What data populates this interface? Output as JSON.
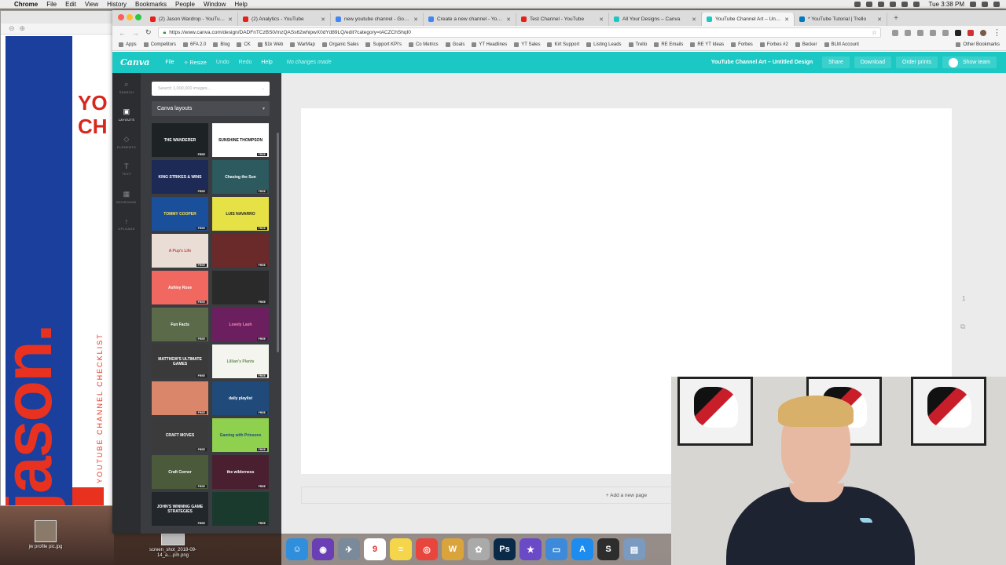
{
  "menubar": {
    "app": "Chrome",
    "items": [
      "File",
      "Edit",
      "View",
      "History",
      "Bookmarks",
      "People",
      "Window",
      "Help"
    ],
    "clock": "Tue 3:38 PM"
  },
  "background_window": {
    "poster_text_top": "YO",
    "poster_text_top2": "CH",
    "poster_brand": "jason.",
    "poster_vertical": "YOUTUBE CHANNEL CHECKLIST"
  },
  "desktop_icons": [
    {
      "label": "jw profile pic.jpg"
    },
    {
      "label": "screen_shot_2018-09-14_a....pm.png"
    }
  ],
  "tabs": [
    {
      "label": "(2) Jason Wardrop - YouTube",
      "color": "#e62117"
    },
    {
      "label": "(2) Analytics - YouTube",
      "color": "#e62117"
    },
    {
      "label": "new youtube channel - Google",
      "color": "#4285f4"
    },
    {
      "label": "Create a new channel - YouTu...",
      "color": "#4285f4"
    },
    {
      "label": "Test Channel - YouTube",
      "color": "#e62117"
    },
    {
      "label": "All Your Designs – Canva",
      "color": "#1bc8c3"
    },
    {
      "label": "YouTube Channel Art – Untitle...",
      "color": "#1bc8c3",
      "active": true
    },
    {
      "label": "* YouTube Tutorial | Trello",
      "color": "#0079bf"
    }
  ],
  "url": "https://www.canva.com/design/DADFnTCzBS0/mzQASs62whipwX0dYd89LQ/edit?category=tACZChShqI0",
  "bookmarks": [
    "Apps",
    "Competitors",
    "6FA 2.0",
    "Blog",
    "CK",
    "$1k Web",
    "WarMap",
    "Organic Sales",
    "Support KPI's",
    "Co Metrics",
    "Goals",
    "YT Headlines",
    "YT Sales",
    "Kirt Support",
    "Listing Leads",
    "Trello",
    "RE Emails",
    "RE YT Ideas",
    "Forbes",
    "Forbes #2",
    "Becker",
    "BLM Account"
  ],
  "bookmarks_other": "Other Bookmarks",
  "canva": {
    "logo": "Canva",
    "menu": {
      "file": "File",
      "resize": "Resize",
      "undo": "Undo",
      "redo": "Redo",
      "help": "Help"
    },
    "status": "No changes made",
    "doc_title": "YouTube Channel Art – Untitled Design",
    "buttons": {
      "share": "Share",
      "download": "Download",
      "order": "Order prints",
      "team": "Show team"
    },
    "rail": [
      {
        "label": "SEARCH",
        "icon": "⌕"
      },
      {
        "label": "LAYOUTS",
        "icon": "▣",
        "active": true
      },
      {
        "label": "ELEMENTS",
        "icon": "◇"
      },
      {
        "label": "TEXT",
        "icon": "T"
      },
      {
        "label": "BKGROUND",
        "icon": "▦"
      },
      {
        "label": "UPLOADS",
        "icon": "↑"
      }
    ],
    "search_placeholder": "Search 1,000,000 images...",
    "layout_select": "Canva layouts",
    "free_badge": "FREE",
    "thumbnails": [
      {
        "text": "THE WANDERER",
        "bg": "#1d2224",
        "fg": "#ffffff"
      },
      {
        "text": "SUNSHINE THOMPSON",
        "bg": "#ffffff",
        "fg": "#111111"
      },
      {
        "text": "KING STRIKES & WINS",
        "bg": "#1e2a56",
        "fg": "#ffffff"
      },
      {
        "text": "Chasing the Sun",
        "bg": "#2c5a5e",
        "fg": "#ffffff"
      },
      {
        "text": "TOMMY COOPER",
        "bg": "#1a4f9c",
        "fg": "#ffe14a"
      },
      {
        "text": "LUIS NAVARRO",
        "bg": "#e6e144",
        "fg": "#222222"
      },
      {
        "text": "A Pup's Life",
        "bg": "#e9ddd6",
        "fg": "#b8504a"
      },
      {
        "text": "",
        "bg": "#6b2a2a",
        "fg": "#ffffff"
      },
      {
        "text": "Ashley Rose",
        "bg": "#f06860",
        "fg": "#ffffff"
      },
      {
        "text": "",
        "bg": "#2a2a2a",
        "fg": "#ffffff"
      },
      {
        "text": "Fun Facts",
        "bg": "#5b6b4a",
        "fg": "#ffffff"
      },
      {
        "text": "Lovely Lash",
        "bg": "#6b1f5f",
        "fg": "#ff87b8"
      },
      {
        "text": "MATTHEW'S ULTIMATE GAMES",
        "bg": "#3a3a3a",
        "fg": "#ffffff"
      },
      {
        "text": "Lillian's Plants",
        "bg": "#f3f5ee",
        "fg": "#6b8b5a"
      },
      {
        "text": "",
        "bg": "#d9866a",
        "fg": "#ffffff"
      },
      {
        "text": "daily playlist",
        "bg": "#1f4a7a",
        "fg": "#ffffff"
      },
      {
        "text": "CRAFT MOVES",
        "bg": "#3b3b3b",
        "fg": "#ffffff"
      },
      {
        "text": "Gaming with Prinsons",
        "bg": "#8fd14f",
        "fg": "#1d4a7a"
      },
      {
        "text": "Craft Corner",
        "bg": "#4a5a3a",
        "fg": "#ffffff"
      },
      {
        "text": "the wilderness",
        "bg": "#4a2030",
        "fg": "#ffffff"
      },
      {
        "text": "JOHN'S WINNING GAME STRATEGIES",
        "bg": "#22272c",
        "fg": "#ffffff"
      },
      {
        "text": "",
        "bg": "#1a3a2e",
        "fg": "#ffffff"
      }
    ],
    "page_number": "1",
    "add_page": "+ Add a new page"
  },
  "dock_apps": [
    {
      "name": "Finder",
      "color": "#2f8fdd",
      "glyph": "☺"
    },
    {
      "name": "Siri",
      "color": "#6a3fb5",
      "glyph": "◉"
    },
    {
      "name": "Launchpad",
      "color": "#7a8a9a",
      "glyph": "✈"
    },
    {
      "name": "Calendar",
      "color": "#ffffff",
      "glyph": "9"
    },
    {
      "name": "Notes",
      "color": "#f5d64a",
      "glyph": "≡"
    },
    {
      "name": "Chrome",
      "color": "#e8453c",
      "glyph": "◎"
    },
    {
      "name": "Vectorize",
      "color": "#d9a43c",
      "glyph": "W"
    },
    {
      "name": "Photos",
      "color": "#aaaaaa",
      "glyph": "✿"
    },
    {
      "name": "Photoshop",
      "color": "#0a2a4a",
      "glyph": "Ps"
    },
    {
      "name": "iMovie",
      "color": "#6b4ac7",
      "glyph": "★"
    },
    {
      "name": "Keynote",
      "color": "#3c8ad9",
      "glyph": "▭"
    },
    {
      "name": "App Store",
      "color": "#1d8cf0",
      "glyph": "A"
    },
    {
      "name": "Slack",
      "color": "#2d2d2d",
      "glyph": "S"
    },
    {
      "name": "Preview",
      "color": "#7a9ac0",
      "glyph": "▤"
    }
  ]
}
